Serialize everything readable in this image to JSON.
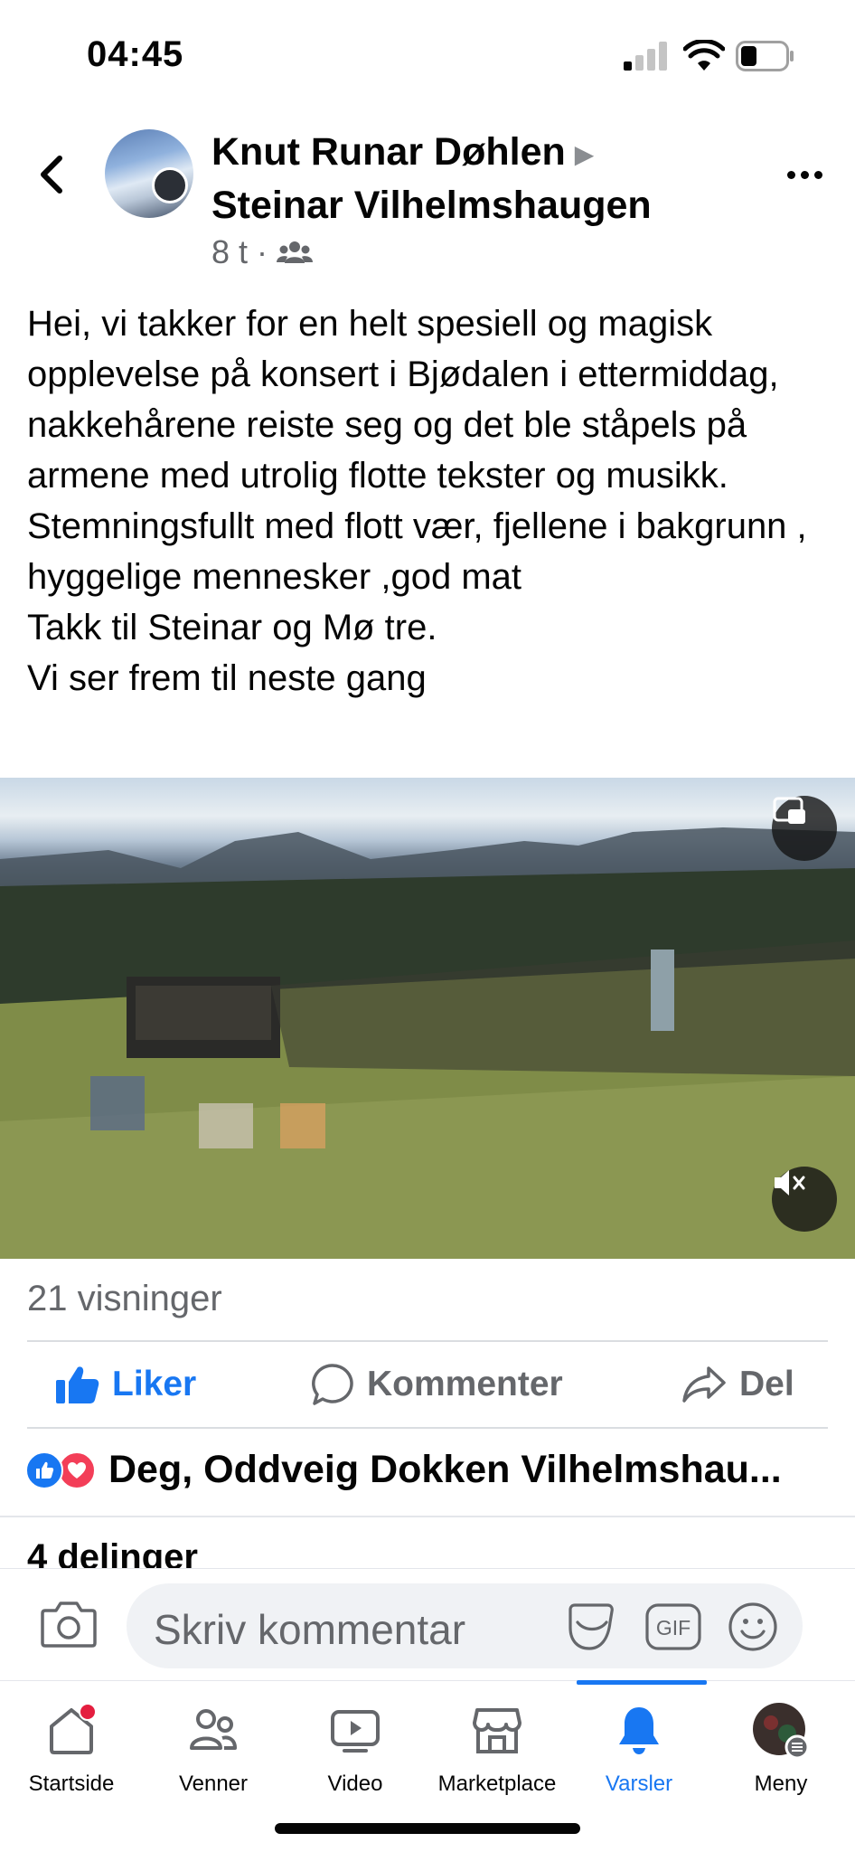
{
  "status_bar": {
    "time": "04:45"
  },
  "header": {
    "author": "Knut Runar Døhlen",
    "author_arrow": "▶",
    "target": "Steinar Vilhelmshaugen",
    "time_ago": "8 t",
    "dot": "·",
    "audience_icon": "group-icon"
  },
  "post": {
    "text": "Hei, vi takker for en helt spesiell og magisk opplevelse på konsert i Bjødalen i ettermiddag, nakkehårene reiste seg og det ble ståpels på armene med utrolig flotte tekster og musikk.\nStemningsfullt med flott vær, fjellene i bakgrunn , hyggelige mennesker ,god mat\nTakk til Steinar og Mø tre.\nVi ser frem til neste gang"
  },
  "video": {
    "pip_icon": "picture-in-picture-icon",
    "mute_icon": "muted-speaker-icon"
  },
  "stats": {
    "views": "21 visninger"
  },
  "actions": {
    "like": "Liker",
    "comment": "Kommenter",
    "share": "Del"
  },
  "reactions": {
    "names": "Deg, Oddveig Dokken Vilhelmshau..."
  },
  "shares": {
    "label": "4 delinger"
  },
  "comment_bar": {
    "placeholder": "Skriv kommentar",
    "gif_label": "GIF"
  },
  "tabs": [
    {
      "label": "Startside",
      "icon": "home-icon",
      "notification": true
    },
    {
      "label": "Venner",
      "icon": "friends-icon"
    },
    {
      "label": "Video",
      "icon": "video-icon"
    },
    {
      "label": "Marketplace",
      "icon": "marketplace-icon"
    },
    {
      "label": "Varsler",
      "icon": "bell-icon",
      "active": true
    },
    {
      "label": "Meny",
      "icon": "profile-menu-icon"
    }
  ],
  "colors": {
    "accent": "#1877f2",
    "text": "#050505",
    "secondary": "#65676b",
    "love": "#f33e58",
    "notification": "#e41e3f"
  }
}
